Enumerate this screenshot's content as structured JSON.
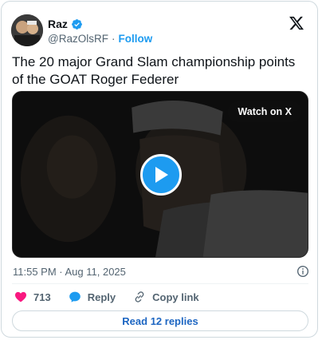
{
  "author": {
    "name": "Raz",
    "handle": "@RazOlsRF",
    "separator": "·",
    "follow_label": "Follow"
  },
  "tweet": {
    "text": "The 20 major Grand Slam championship points of the GOAT Roger Federer",
    "timestamp": "11:55 PM · Aug 11, 2025"
  },
  "media": {
    "watch_label": "Watch on X"
  },
  "actions": {
    "likes_count": "713",
    "reply_label": "Reply",
    "copy_link_label": "Copy link"
  },
  "footer": {
    "read_replies_label": "Read 12 replies"
  },
  "colors": {
    "accent": "#1d9bf0",
    "like": "#f91880",
    "muted": "#536471",
    "border": "#cfd9de"
  },
  "icons": [
    "avatar",
    "verified-badge-icon",
    "x-logo-icon",
    "play-icon",
    "info-icon",
    "heart-icon",
    "reply-bubble-icon",
    "link-icon"
  ]
}
